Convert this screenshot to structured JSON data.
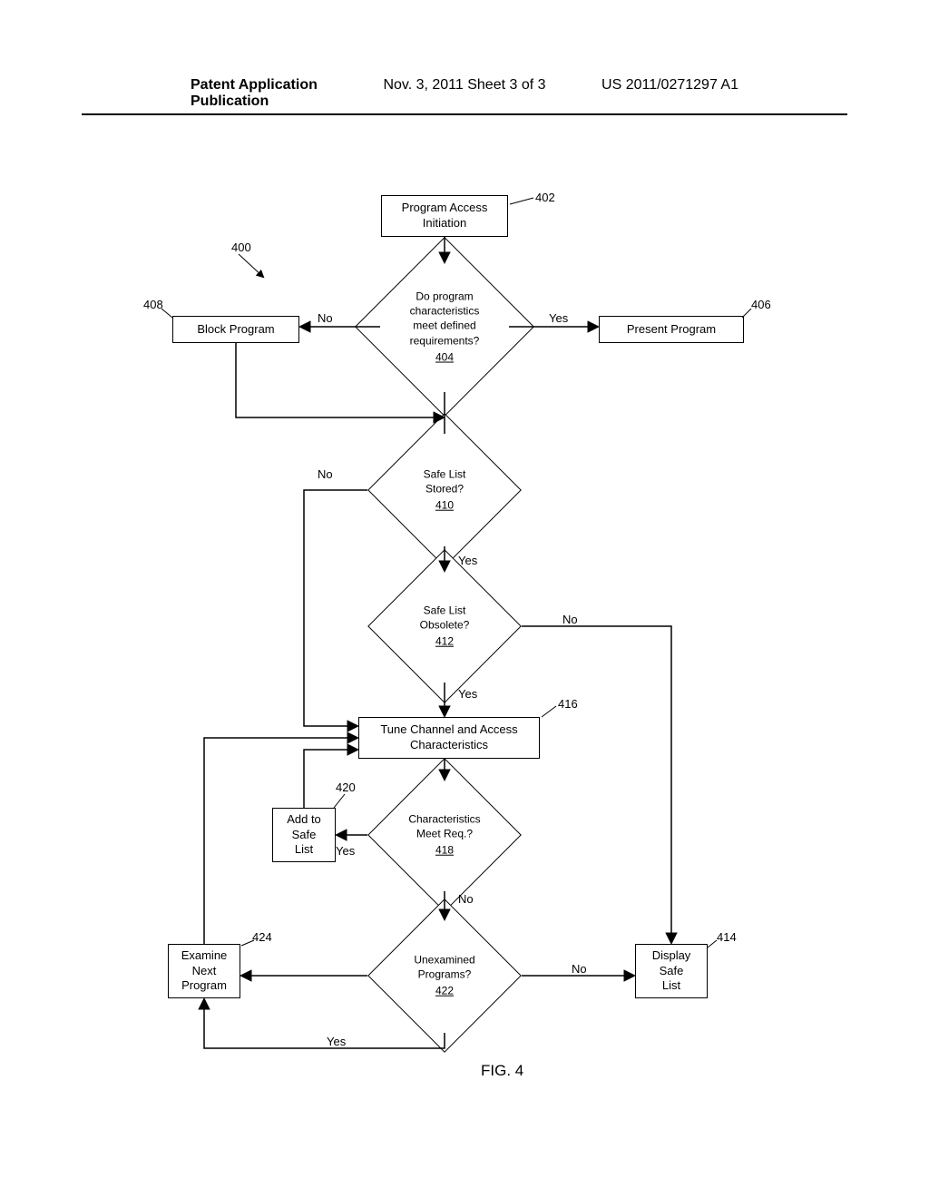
{
  "header": {
    "left": "Patent Application Publication",
    "center": "Nov. 3, 2011  Sheet 3 of 3",
    "right": "US 2011/0271297 A1"
  },
  "nodes": {
    "n402": {
      "text": "Program Access\nInitiation",
      "ref": "402"
    },
    "n404": {
      "text": "Do program\ncharacteristics\nmeet defined\nrequirements?",
      "ref": "404"
    },
    "n406": {
      "text": "Present Program",
      "ref": "406"
    },
    "n408": {
      "text": "Block Program",
      "ref": "408"
    },
    "n410": {
      "text": "Safe List\nStored?",
      "ref": "410"
    },
    "n412": {
      "text": "Safe List\nObsolete?",
      "ref": "412"
    },
    "n416": {
      "text": "Tune Channel and Access\nCharacteristics",
      "ref": "416"
    },
    "n418": {
      "text": "Characteristics\nMeet Req.?",
      "ref": "418"
    },
    "n420": {
      "text": "Add to\nSafe\nList",
      "ref": "420"
    },
    "n422": {
      "text": "Unexamined\nPrograms?",
      "ref": "422"
    },
    "n424": {
      "text": "Examine\nNext\nProgram",
      "ref": "424"
    },
    "n414": {
      "text": "Display\nSafe\nList",
      "ref": "414"
    }
  },
  "edges": {
    "yes": "Yes",
    "no": "No"
  },
  "pointer400": "400",
  "figLabel": "FIG. 4"
}
